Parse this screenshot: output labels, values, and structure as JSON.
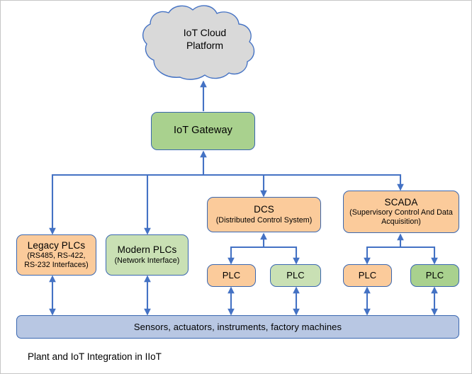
{
  "diagram": {
    "caption": "Plant and IoT Integration in IIoT",
    "colors": {
      "orange": "#fbcb9b",
      "green_dark": "#a9d18e",
      "green_light": "#c9e0b4",
      "blue_bar": "#b8c7e3",
      "cloud_gray": "#d9d9d9",
      "connector_blue": "#4472c4",
      "node_border": "#3a67b0",
      "frame_border": "#c6c6c6"
    },
    "cloud": {
      "line1": "IoT Cloud",
      "line2": "Platform",
      "fill": "#d9d9d9"
    },
    "gateway": {
      "title": "IoT Gateway"
    },
    "tier2": [
      {
        "title": "Legacy PLCs",
        "subtitle": "(RS485, RS-422, RS-232 Interfaces)",
        "fill": "#fbcb9b"
      },
      {
        "title": "Modern PLCs",
        "subtitle": "(Network Interface)",
        "fill": "#c9e0b4"
      },
      {
        "title": "DCS",
        "subtitle": "(Distributed Control System)",
        "fill": "#fbcb9b"
      },
      {
        "title": "SCADA",
        "subtitle": "(Supervisory Control And Data Acquisition)",
        "fill": "#fbcb9b"
      }
    ],
    "plcs": [
      {
        "title": "PLC",
        "fill": "#fbcb9b",
        "parent": "DCS"
      },
      {
        "title": "PLC",
        "fill": "#c9e0b4",
        "parent": "DCS"
      },
      {
        "title": "PLC",
        "fill": "#fbcb9b",
        "parent": "SCADA"
      },
      {
        "title": "PLC",
        "fill": "#a9d18e",
        "parent": "SCADA"
      }
    ],
    "field_layer": {
      "title": "Sensors, actuators, instruments, factory machines"
    }
  }
}
